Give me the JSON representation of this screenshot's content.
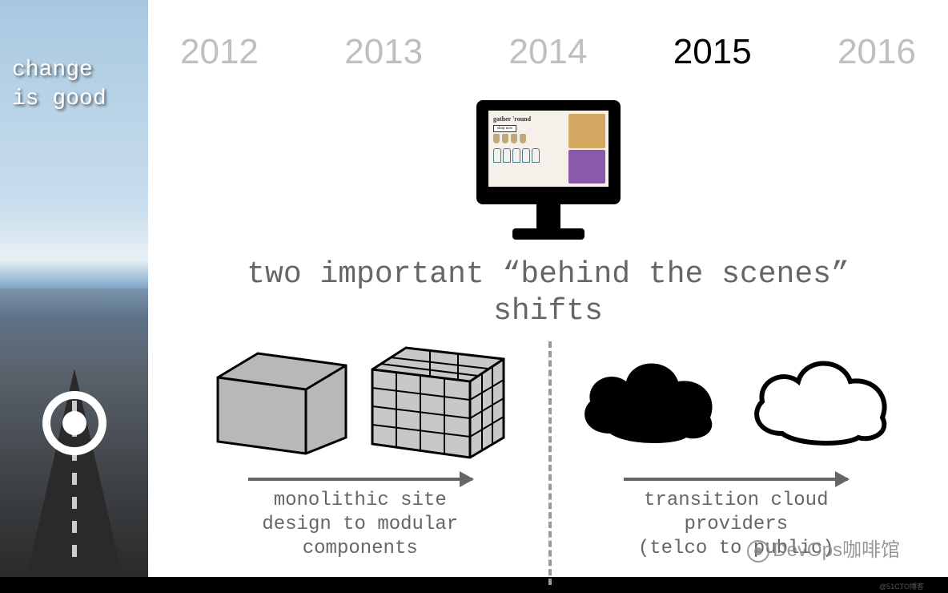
{
  "sidebar": {
    "tagline_line1": "change",
    "tagline_line2": "is good"
  },
  "timeline": {
    "years": [
      "2012",
      "2013",
      "2014",
      "2015",
      "2016"
    ],
    "active_index": 3
  },
  "screen": {
    "headline": "gather 'round",
    "button": "shop now"
  },
  "headline": {
    "line1": "two important “behind the scenes”",
    "line2": "shifts"
  },
  "left_col": {
    "caption_line1": "monolithic site",
    "caption_line2": "design to modular",
    "caption_line3": "components"
  },
  "right_col": {
    "caption_line1": "transition cloud",
    "caption_line2": "providers",
    "caption_line3": "(telco to public)"
  },
  "watermark": "DevOps咖啡馆",
  "footer": "@51CTO博客"
}
